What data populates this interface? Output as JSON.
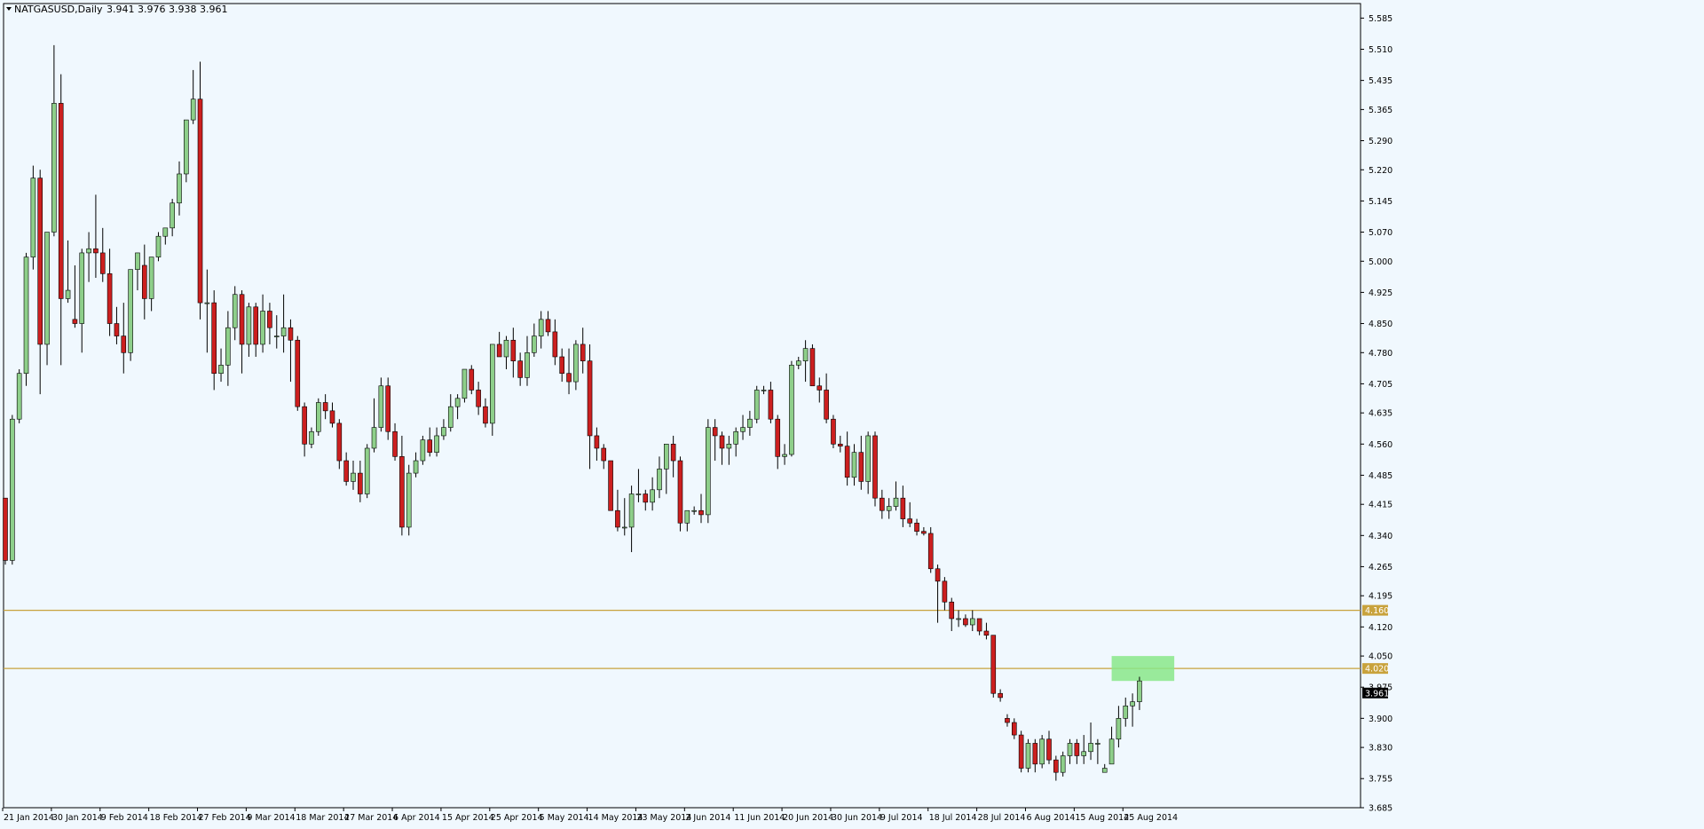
{
  "header": {
    "symbol": "NATGASUSD,Daily",
    "ohlc": "3.941 3.976 3.938 3.961"
  },
  "colors": {
    "background": "#f0f8fe",
    "up": "#8ecf8a",
    "down": "#cc1f1f",
    "wick": "#000000",
    "level_line": "#c8a23c",
    "zone": "#8ae88a",
    "axis": "#000000"
  },
  "chart_data": {
    "type": "candlestick",
    "title": "",
    "ylim": [
      3.685,
      5.62
    ],
    "y_ticks": [
      "5.585",
      "5.510",
      "5.435",
      "5.365",
      "5.290",
      "5.220",
      "5.145",
      "5.070",
      "5.000",
      "4.925",
      "4.850",
      "4.780",
      "4.705",
      "4.635",
      "4.560",
      "4.485",
      "4.415",
      "4.340",
      "4.265",
      "4.195",
      "4.120",
      "4.050",
      "3.975",
      "3.900",
      "3.830",
      "3.755",
      "3.685"
    ],
    "x_ticks": [
      "21 Jan 2014",
      "30 Jan 2014",
      "9 Feb 2014",
      "18 Feb 2014",
      "27 Feb 2014",
      "9 Mar 2014",
      "18 Mar 2014",
      "27 Mar 2014",
      "6 Apr 2014",
      "15 Apr 2014",
      "25 Apr 2014",
      "5 May 2014",
      "14 May 2014",
      "23 May 2014",
      "2 Jun 2014",
      "11 Jun 2014",
      "20 Jun 2014",
      "30 Jun 2014",
      "9 Jul 2014",
      "18 Jul 2014",
      "28 Jul 2014",
      "6 Aug 2014",
      "15 Aug 2014",
      "25 Aug 2014"
    ],
    "x_tick_bar_index": [
      0,
      7,
      14,
      21,
      28,
      35,
      42,
      49,
      56,
      63,
      70,
      77,
      84,
      91,
      98,
      105,
      112,
      119,
      126,
      133,
      140,
      147,
      154,
      161
    ],
    "levels": [
      {
        "label": "4.160",
        "value": 4.16
      },
      {
        "label": "4.020",
        "value": 4.02
      }
    ],
    "current_price": {
      "label": "3.961",
      "value": 3.961
    },
    "zone": {
      "start_bar": 159,
      "end_bar": 168,
      "low": 3.99,
      "high": 4.05
    },
    "candles": [
      [
        4.43,
        4.43,
        4.27,
        4.28
      ],
      [
        4.28,
        4.63,
        4.27,
        4.62
      ],
      [
        4.62,
        4.74,
        4.61,
        4.73
      ],
      [
        4.73,
        5.02,
        4.7,
        5.01
      ],
      [
        5.01,
        5.23,
        4.98,
        5.2
      ],
      [
        5.2,
        5.22,
        4.68,
        4.8
      ],
      [
        4.8,
        5.07,
        4.75,
        5.07
      ],
      [
        5.07,
        5.52,
        5.06,
        5.38
      ],
      [
        5.38,
        5.45,
        4.75,
        4.91
      ],
      [
        4.91,
        5.05,
        4.9,
        4.93
      ],
      [
        4.86,
        4.99,
        4.84,
        4.85
      ],
      [
        4.85,
        5.03,
        4.78,
        5.02
      ],
      [
        5.02,
        5.07,
        4.95,
        5.03
      ],
      [
        5.03,
        5.16,
        4.96,
        5.02
      ],
      [
        5.02,
        5.08,
        4.95,
        4.97
      ],
      [
        4.97,
        5.03,
        4.82,
        4.85
      ],
      [
        4.85,
        4.89,
        4.8,
        4.82
      ],
      [
        4.82,
        4.9,
        4.73,
        4.78
      ],
      [
        4.78,
        4.98,
        4.76,
        4.98
      ],
      [
        4.98,
        5.02,
        4.93,
        5.02
      ],
      [
        4.99,
        5.04,
        4.86,
        4.91
      ],
      [
        4.91,
        5.01,
        4.88,
        5.01
      ],
      [
        5.01,
        5.07,
        5.0,
        5.06
      ],
      [
        5.06,
        5.08,
        5.04,
        5.08
      ],
      [
        5.08,
        5.15,
        5.06,
        5.14
      ],
      [
        5.14,
        5.24,
        5.11,
        5.21
      ],
      [
        5.21,
        5.33,
        5.19,
        5.34
      ],
      [
        5.34,
        5.46,
        5.33,
        5.39
      ],
      [
        5.39,
        5.48,
        4.86,
        4.9
      ],
      [
        4.9,
        4.98,
        4.78,
        4.9
      ],
      [
        4.9,
        4.93,
        4.69,
        4.73
      ],
      [
        4.73,
        4.79,
        4.71,
        4.75
      ],
      [
        4.75,
        4.88,
        4.7,
        4.84
      ],
      [
        4.84,
        4.94,
        4.81,
        4.92
      ],
      [
        4.92,
        4.93,
        4.73,
        4.8
      ],
      [
        4.8,
        4.9,
        4.77,
        4.89
      ],
      [
        4.89,
        4.9,
        4.77,
        4.8
      ],
      [
        4.8,
        4.92,
        4.78,
        4.88
      ],
      [
        4.88,
        4.9,
        4.8,
        4.84
      ],
      [
        4.82,
        4.87,
        4.79,
        4.82
      ],
      [
        4.82,
        4.92,
        4.78,
        4.84
      ],
      [
        4.84,
        4.86,
        4.71,
        4.81
      ],
      [
        4.81,
        4.82,
        4.64,
        4.65
      ],
      [
        4.65,
        4.66,
        4.53,
        4.56
      ],
      [
        4.56,
        4.6,
        4.55,
        4.59
      ],
      [
        4.59,
        4.67,
        4.58,
        4.66
      ],
      [
        4.66,
        4.68,
        4.62,
        4.64
      ],
      [
        4.64,
        4.66,
        4.6,
        4.61
      ],
      [
        4.61,
        4.62,
        4.5,
        4.52
      ],
      [
        4.52,
        4.54,
        4.46,
        4.47
      ],
      [
        4.47,
        4.52,
        4.45,
        4.49
      ],
      [
        4.49,
        4.52,
        4.42,
        4.44
      ],
      [
        4.44,
        4.56,
        4.43,
        4.55
      ],
      [
        4.55,
        4.67,
        4.54,
        4.6
      ],
      [
        4.6,
        4.72,
        4.59,
        4.7
      ],
      [
        4.7,
        4.72,
        4.57,
        4.59
      ],
      [
        4.59,
        4.61,
        4.52,
        4.53
      ],
      [
        4.53,
        4.58,
        4.34,
        4.36
      ],
      [
        4.36,
        4.51,
        4.34,
        4.49
      ],
      [
        4.49,
        4.54,
        4.48,
        4.52
      ],
      [
        4.52,
        4.58,
        4.51,
        4.57
      ],
      [
        4.57,
        4.6,
        4.53,
        4.54
      ],
      [
        4.54,
        4.6,
        4.53,
        4.58
      ],
      [
        4.58,
        4.62,
        4.57,
        4.6
      ],
      [
        4.6,
        4.68,
        4.59,
        4.65
      ],
      [
        4.65,
        4.68,
        4.62,
        4.67
      ],
      [
        4.67,
        4.74,
        4.66,
        4.74
      ],
      [
        4.74,
        4.75,
        4.68,
        4.69
      ],
      [
        4.69,
        4.71,
        4.63,
        4.65
      ],
      [
        4.65,
        4.67,
        4.6,
        4.61
      ],
      [
        4.61,
        4.8,
        4.58,
        4.8
      ],
      [
        4.8,
        4.83,
        4.77,
        4.77
      ],
      [
        4.77,
        4.82,
        4.74,
        4.81
      ],
      [
        4.81,
        4.84,
        4.72,
        4.76
      ],
      [
        4.76,
        4.78,
        4.7,
        4.72
      ],
      [
        4.72,
        4.82,
        4.7,
        4.78
      ],
      [
        4.78,
        4.85,
        4.77,
        4.82
      ],
      [
        4.82,
        4.88,
        4.79,
        4.86
      ],
      [
        4.86,
        4.88,
        4.82,
        4.83
      ],
      [
        4.83,
        4.86,
        4.75,
        4.77
      ],
      [
        4.77,
        4.79,
        4.71,
        4.73
      ],
      [
        4.73,
        4.79,
        4.68,
        4.71
      ],
      [
        4.71,
        4.81,
        4.69,
        4.8
      ],
      [
        4.8,
        4.84,
        4.73,
        4.76
      ],
      [
        4.76,
        4.8,
        4.5,
        4.58
      ],
      [
        4.58,
        4.6,
        4.52,
        4.55
      ],
      [
        4.55,
        4.56,
        4.5,
        4.52
      ],
      [
        4.52,
        4.52,
        4.4,
        4.4
      ],
      [
        4.4,
        4.45,
        4.35,
        4.36
      ],
      [
        4.36,
        4.43,
        4.34,
        4.36
      ],
      [
        4.36,
        4.46,
        4.3,
        4.44
      ],
      [
        4.44,
        4.5,
        4.42,
        4.44
      ],
      [
        4.44,
        4.45,
        4.4,
        4.42
      ],
      [
        4.42,
        4.48,
        4.4,
        4.45
      ],
      [
        4.45,
        4.53,
        4.43,
        4.5
      ],
      [
        4.5,
        4.56,
        4.44,
        4.56
      ],
      [
        4.56,
        4.58,
        4.48,
        4.52
      ],
      [
        4.52,
        4.53,
        4.35,
        4.37
      ],
      [
        4.37,
        4.4,
        4.35,
        4.4
      ],
      [
        4.4,
        4.41,
        4.39,
        4.4
      ],
      [
        4.4,
        4.44,
        4.37,
        4.39
      ],
      [
        4.39,
        4.62,
        4.37,
        4.6
      ],
      [
        4.6,
        4.62,
        4.52,
        4.58
      ],
      [
        4.58,
        4.59,
        4.51,
        4.55
      ],
      [
        4.55,
        4.58,
        4.51,
        4.56
      ],
      [
        4.56,
        4.6,
        4.53,
        4.59
      ],
      [
        4.59,
        4.63,
        4.57,
        4.6
      ],
      [
        4.6,
        4.64,
        4.58,
        4.62
      ],
      [
        4.62,
        4.7,
        4.61,
        4.69
      ],
      [
        4.69,
        4.7,
        4.68,
        4.69
      ],
      [
        4.69,
        4.71,
        4.61,
        4.62
      ],
      [
        4.62,
        4.63,
        4.5,
        4.53
      ],
      [
        4.53,
        4.56,
        4.51,
        4.535
      ],
      [
        4.535,
        4.76,
        4.53,
        4.75
      ],
      [
        4.75,
        4.77,
        4.74,
        4.76
      ],
      [
        4.76,
        4.81,
        4.71,
        4.79
      ],
      [
        4.79,
        4.8,
        4.7,
        4.7
      ],
      [
        4.7,
        4.72,
        4.66,
        4.69
      ],
      [
        4.69,
        4.73,
        4.61,
        4.62
      ],
      [
        4.62,
        4.63,
        4.55,
        4.56
      ],
      [
        4.56,
        4.58,
        4.54,
        4.555
      ],
      [
        4.555,
        4.59,
        4.46,
        4.48
      ],
      [
        4.48,
        4.56,
        4.46,
        4.54
      ],
      [
        4.54,
        4.58,
        4.45,
        4.47
      ],
      [
        4.47,
        4.59,
        4.44,
        4.58
      ],
      [
        4.58,
        4.59,
        4.41,
        4.43
      ],
      [
        4.43,
        4.45,
        4.38,
        4.4
      ],
      [
        4.4,
        4.43,
        4.38,
        4.41
      ],
      [
        4.41,
        4.47,
        4.4,
        4.43
      ],
      [
        4.43,
        4.46,
        4.36,
        4.38
      ],
      [
        4.38,
        4.42,
        4.36,
        4.37
      ],
      [
        4.37,
        4.38,
        4.34,
        4.35
      ],
      [
        4.35,
        4.36,
        4.34,
        4.345
      ],
      [
        4.345,
        4.36,
        4.25,
        4.26
      ],
      [
        4.26,
        4.27,
        4.13,
        4.23
      ],
      [
        4.23,
        4.24,
        4.16,
        4.18
      ],
      [
        4.18,
        4.19,
        4.11,
        4.14
      ],
      [
        4.14,
        4.16,
        4.12,
        4.14
      ],
      [
        4.14,
        4.15,
        4.12,
        4.125
      ],
      [
        4.125,
        4.16,
        4.11,
        4.14
      ],
      [
        4.14,
        4.14,
        4.1,
        4.11
      ],
      [
        4.11,
        4.13,
        4.09,
        4.1
      ],
      [
        4.1,
        4.1,
        3.95,
        3.96
      ],
      [
        3.96,
        3.97,
        3.94,
        3.95
      ],
      [
        3.9,
        3.91,
        3.88,
        3.89
      ],
      [
        3.89,
        3.9,
        3.85,
        3.86
      ],
      [
        3.86,
        3.87,
        3.77,
        3.78
      ],
      [
        3.78,
        3.85,
        3.77,
        3.84
      ],
      [
        3.84,
        3.85,
        3.77,
        3.79
      ],
      [
        3.79,
        3.86,
        3.78,
        3.85
      ],
      [
        3.85,
        3.87,
        3.79,
        3.8
      ],
      [
        3.8,
        3.81,
        3.75,
        3.77
      ],
      [
        3.77,
        3.82,
        3.76,
        3.81
      ],
      [
        3.81,
        3.85,
        3.79,
        3.84
      ],
      [
        3.84,
        3.85,
        3.79,
        3.81
      ],
      [
        3.81,
        3.86,
        3.79,
        3.82
      ],
      [
        3.82,
        3.89,
        3.8,
        3.84
      ],
      [
        3.84,
        3.85,
        3.79,
        3.84
      ],
      [
        3.77,
        3.79,
        3.77,
        3.78
      ],
      [
        3.79,
        3.88,
        3.79,
        3.85
      ],
      [
        3.85,
        3.93,
        3.83,
        3.9
      ],
      [
        3.9,
        3.95,
        3.88,
        3.93
      ],
      [
        3.93,
        3.96,
        3.88,
        3.94
      ],
      [
        3.94,
        4.0,
        3.92,
        3.99
      ]
    ]
  }
}
